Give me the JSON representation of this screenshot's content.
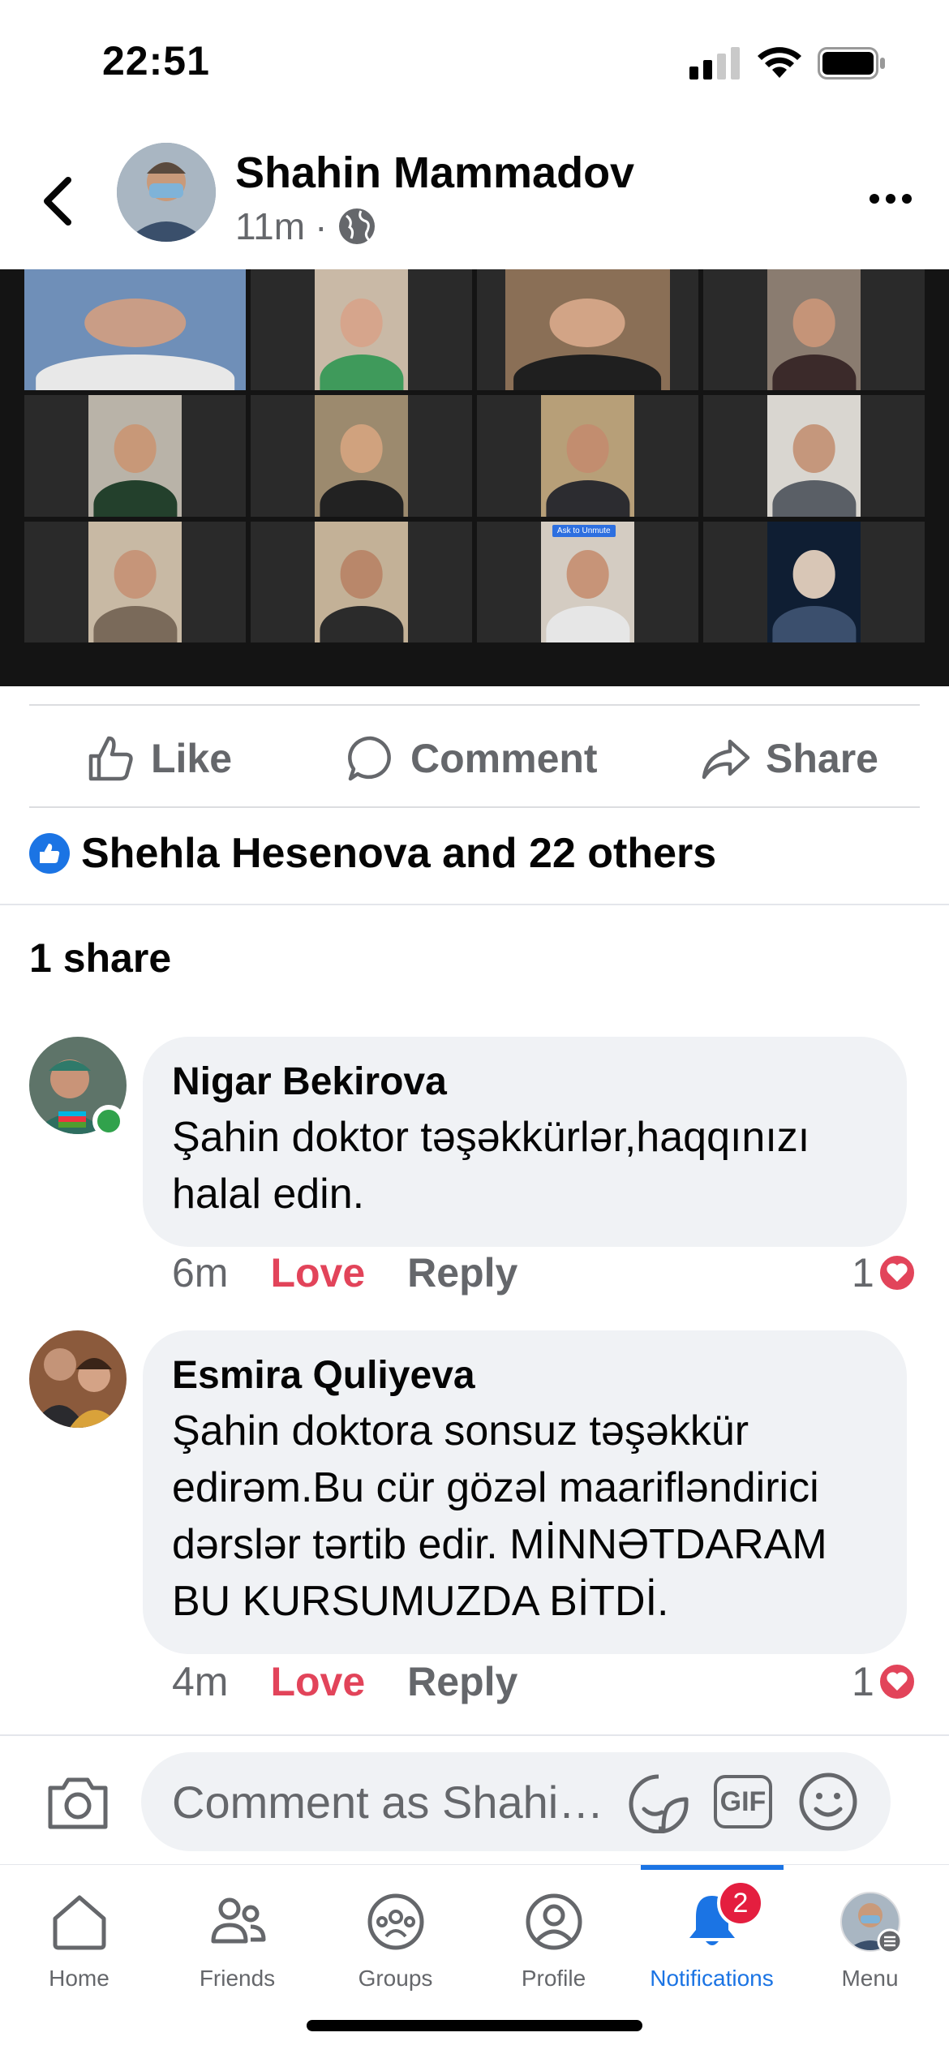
{
  "status_bar": {
    "time": "22:51"
  },
  "post": {
    "author": "Shahin Mammadov",
    "time_ago": "11m",
    "meta_separator": "·",
    "media_unmute_chip": "Ask to Unmute"
  },
  "actions": {
    "like": "Like",
    "comment": "Comment",
    "share": "Share"
  },
  "reactions_summary": "Shehla Hesenova and 22 others",
  "shares_count": "1 share",
  "comments": [
    {
      "name": "Nigar  Bekirova",
      "text": "Şahin doktor  təşəkkürlər,haqqınızı halal edin.",
      "time": "6m",
      "reaction_label": "Love",
      "reply_label": "Reply",
      "reaction_count": "1"
    },
    {
      "name": "Esmira Quliyeva",
      "text": "Şahin doktora sonsuz təşəkkür edirəm.Bu cür gözəl maarifləndirici dərslər tərtib edir. MİNNƏTDARAM BU KURSUMUZDA BİTDİ.",
      "time": "4m",
      "reaction_label": "Love",
      "reply_label": "Reply",
      "reaction_count": "1"
    }
  ],
  "composer": {
    "placeholder": "Comment as Shahi…",
    "gif_label": "GIF"
  },
  "tab_bar": {
    "tabs": [
      {
        "label": "Home",
        "icon": "home-icon"
      },
      {
        "label": "Friends",
        "icon": "friends-icon"
      },
      {
        "label": "Groups",
        "icon": "groups-icon"
      },
      {
        "label": "Profile",
        "icon": "profile-icon"
      },
      {
        "label": "Notifications",
        "icon": "bell-icon"
      },
      {
        "label": "Menu",
        "icon": "menu-avatar"
      }
    ],
    "active_tab": "Notifications",
    "notifications_badge": "2"
  },
  "colors": {
    "accent": "#1b74e4",
    "love": "#e2445a",
    "secondary_text": "#65676b"
  }
}
